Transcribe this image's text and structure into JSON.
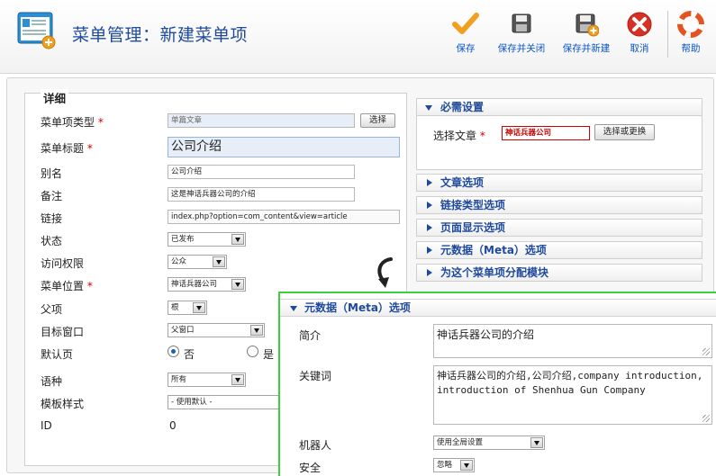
{
  "header": {
    "title": "菜单管理：新建菜单项",
    "toolbar": [
      {
        "label": "保存",
        "icon": "save-check-icon"
      },
      {
        "label": "保存并关闭",
        "icon": "save-close-icon"
      },
      {
        "label": "保存并新建",
        "icon": "save-new-icon"
      },
      {
        "label": "取消",
        "icon": "cancel-icon"
      },
      {
        "label": "帮助",
        "icon": "help-icon"
      }
    ]
  },
  "details": {
    "legend": "详细",
    "fields": {
      "type": {
        "label": "菜单项类型",
        "value": "单篇文章",
        "button": "选择"
      },
      "title": {
        "label": "菜单标题",
        "value": "公司介绍"
      },
      "alias": {
        "label": "别名",
        "value": "公司介绍"
      },
      "note": {
        "label": "备注",
        "value": "这是神话兵器公司的介绍"
      },
      "link": {
        "label": "链接",
        "value": "index.php?option=com_content&view=article"
      },
      "status": {
        "label": "状态",
        "value": "已发布"
      },
      "access": {
        "label": "访问权限",
        "value": "公众"
      },
      "menu": {
        "label": "菜单位置",
        "value": "神话兵器公司"
      },
      "parent": {
        "label": "父项",
        "value": "根"
      },
      "target": {
        "label": "目标窗口",
        "value": "父窗口"
      },
      "home": {
        "label": "默认页",
        "no": "否",
        "yes": "是"
      },
      "language": {
        "label": "语种",
        "value": "所有"
      },
      "template": {
        "label": "模板样式",
        "value": "- 使用默认 -"
      },
      "id": {
        "label": "ID",
        "value": "0"
      }
    },
    "required_mark": "*"
  },
  "right_panel": {
    "required": {
      "title": "必需设置",
      "article_label": "选择文章",
      "article_value": "神话兵器公司",
      "article_button": "选择或更换"
    },
    "sections": [
      "文章选项",
      "链接类型选项",
      "页面显示选项",
      "元数据（Meta）选项",
      "为这个菜单项分配模块"
    ]
  },
  "overlay": {
    "title": "元数据（Meta）选项",
    "desc_label": "简介",
    "desc_value": "神话兵器公司的介绍",
    "keywords_label": "关键词",
    "keywords_value": "神话兵器公司的介绍,公司介绍,company introduction, introduction of Shenhua Gun Company",
    "robots_label": "机器人",
    "robots_value": "使用全局设置",
    "secure_label": "安全",
    "secure_value": "忽略"
  },
  "colors": {
    "title_blue": "#1f4a9c",
    "required_red": "#cc0000",
    "highlight_green": "#3ecf3e",
    "cancel_red": "#d93025",
    "save_orange": "#f0a020"
  }
}
